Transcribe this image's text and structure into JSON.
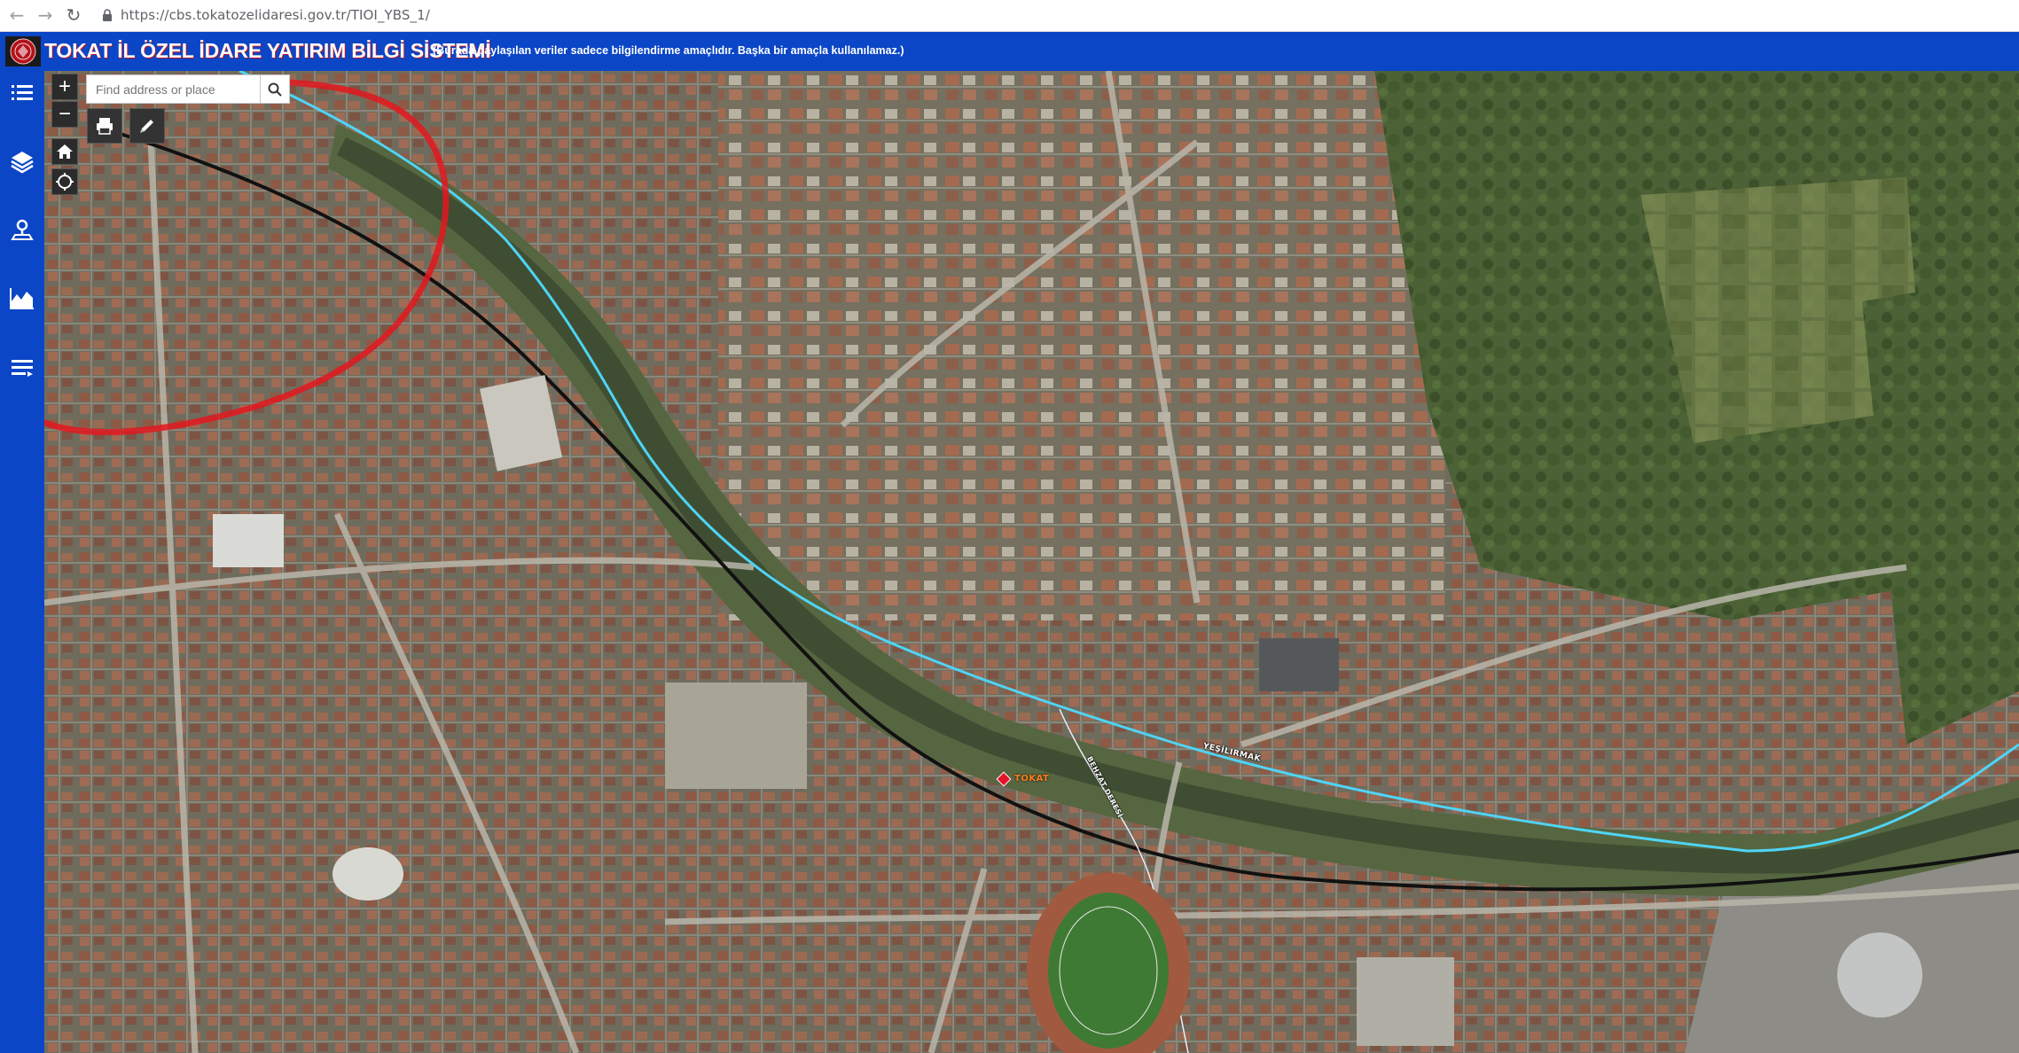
{
  "browser": {
    "url": "https://cbs.tokatozelidaresi.gov.tr/TIOI_YBS_1/",
    "back_icon": "arrow-left-icon",
    "forward_icon": "arrow-right-icon",
    "reload_icon": "reload-icon"
  },
  "header": {
    "title": "TOKAT İL ÖZEL İDARE YATIRIM BİLGİ SİSTEMİ",
    "disclaimer": "(Burada paylaşılan veriler sadece bilgilendirme amaçlıdır. Başka bir amaçla kullanılamaz.)",
    "background_color": "#0b46c6"
  },
  "sidebar": {
    "items": [
      {
        "icon": "list-icon"
      },
      {
        "icon": "layers-icon"
      },
      {
        "icon": "location-pin-icon"
      },
      {
        "icon": "chart-area-icon"
      },
      {
        "icon": "legend-icon"
      }
    ]
  },
  "map": {
    "search": {
      "placeholder": "Find address or place"
    },
    "controls": {
      "zoom_in": "+",
      "zoom_out": "−"
    },
    "labels": {
      "city": "TOKAT",
      "river": "YEŞİLIRMAK",
      "stream": "BEHZAT DERESİ"
    },
    "colors": {
      "river_line": "#4fd4f5",
      "rail_line": "#111111",
      "highlight_circle": "#e3181f",
      "marker": "#e3142b"
    }
  }
}
